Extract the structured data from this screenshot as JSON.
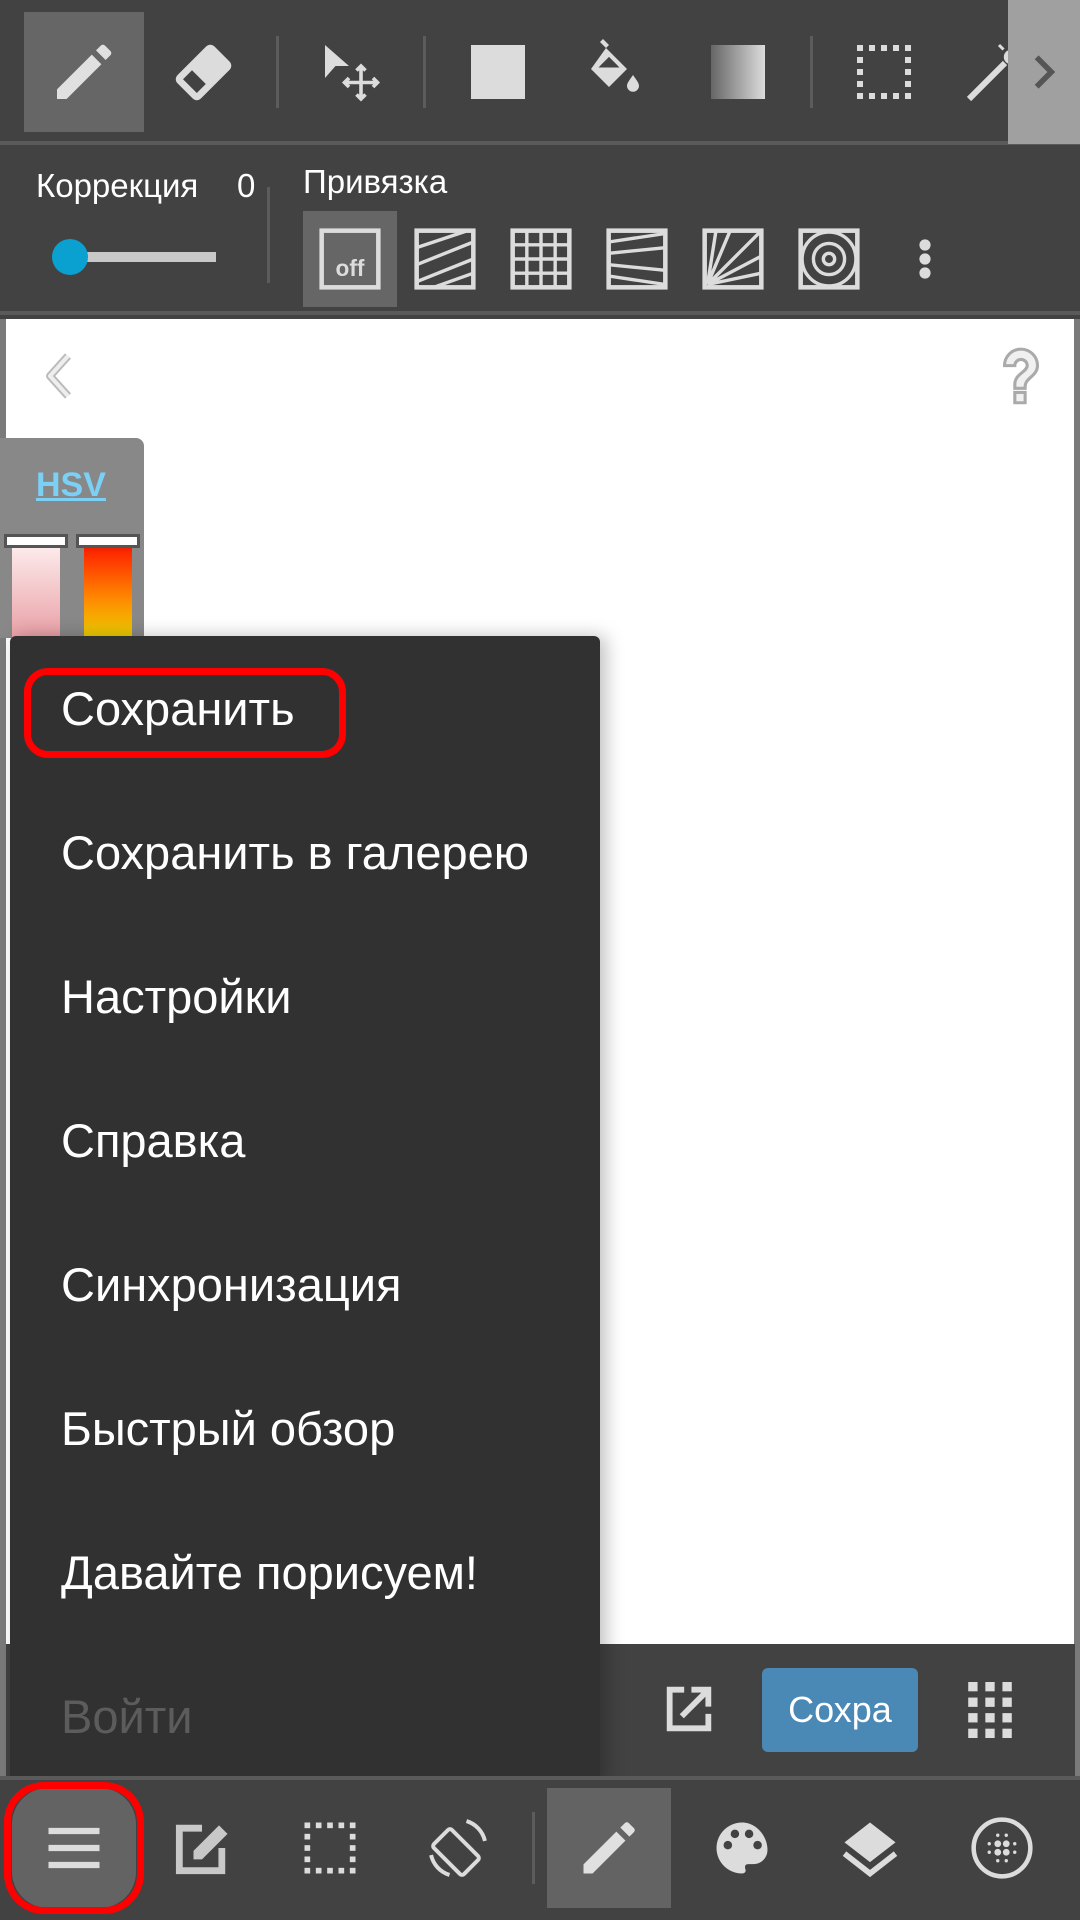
{
  "top_toolbar": {
    "tools": [
      {
        "name": "pen",
        "icon": "pencil-icon",
        "active": true
      },
      {
        "name": "eraser",
        "icon": "eraser-icon",
        "active": false
      },
      {
        "name": "move",
        "icon": "move-icon",
        "active": false
      },
      {
        "name": "fill-shape",
        "icon": "square-icon",
        "active": false
      },
      {
        "name": "bucket",
        "icon": "paint-bucket-icon",
        "active": false
      },
      {
        "name": "gradient",
        "icon": "gradient-icon",
        "active": false
      },
      {
        "name": "select",
        "icon": "selection-icon",
        "active": false
      },
      {
        "name": "magic-wand",
        "icon": "magic-wand-icon",
        "active": false
      }
    ],
    "more_icon": "chevron-right-icon"
  },
  "sub_toolbar": {
    "correction_label": "Коррекция",
    "correction_value": "0",
    "correction_slider_fraction": 0,
    "snap_label": "Привязка",
    "snap_off_text": "off",
    "snap_modes": [
      "off",
      "parallel",
      "grid",
      "perspective",
      "radial",
      "concentric"
    ],
    "active_snap": "off"
  },
  "color_panel": {
    "mode_label": "HSV",
    "accent_color": "#7bd0f5"
  },
  "menu": {
    "items": [
      {
        "label": "Сохранить",
        "highlighted": true,
        "disabled": false
      },
      {
        "label": "Сохранить в галерею",
        "highlighted": false,
        "disabled": false
      },
      {
        "label": "Настройки",
        "highlighted": false,
        "disabled": false
      },
      {
        "label": "Справка",
        "highlighted": false,
        "disabled": false
      },
      {
        "label": "Синхронизация",
        "highlighted": false,
        "disabled": false
      },
      {
        "label": "Быстрый обзор",
        "highlighted": false,
        "disabled": false
      },
      {
        "label": "Давайте порисуем!",
        "highlighted": false,
        "disabled": false
      },
      {
        "label": "Войти",
        "highlighted": false,
        "disabled": true
      }
    ]
  },
  "action_bar": {
    "save_label": "Сохра",
    "save_color": "#4a88b5"
  },
  "bottom_nav": {
    "items": [
      {
        "name": "menu",
        "icon": "hamburger-icon",
        "active": false,
        "highlighted": true
      },
      {
        "name": "edit",
        "icon": "edit-icon",
        "active": false
      },
      {
        "name": "selection",
        "icon": "selection-icon",
        "active": false
      },
      {
        "name": "rotate",
        "icon": "rotate-screen-icon",
        "active": false
      },
      {
        "name": "brush",
        "icon": "pencil-icon",
        "active": true
      },
      {
        "name": "color",
        "icon": "palette-icon",
        "active": false
      },
      {
        "name": "layers",
        "icon": "layers-icon",
        "active": false
      },
      {
        "name": "material",
        "icon": "texture-icon",
        "active": false
      }
    ]
  },
  "colors": {
    "highlight": "#ff0000",
    "slider_thumb": "#0aa0d0"
  }
}
